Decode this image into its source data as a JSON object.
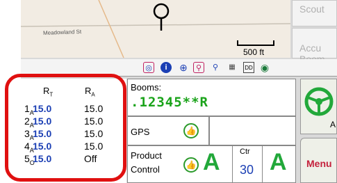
{
  "map": {
    "road_label": "Meadowland St",
    "scale_label": "500 ft"
  },
  "right_column": {
    "scout_label": "Scout",
    "accu_boom_label": "Accu\nBoom"
  },
  "toolbar": {
    "icons": [
      "position-marker-icon",
      "info-icon",
      "crosshair-icon",
      "zoom-in-icon",
      "zoom-out-icon",
      "grid-icon",
      "dd-icon",
      "globe-icon"
    ]
  },
  "rates": {
    "target_header": "RT",
    "actual_header": "RA",
    "rows": [
      {
        "section": "1",
        "section_sub": "A",
        "target": "15.0",
        "actual": "15.0"
      },
      {
        "section": "2",
        "section_sub": "A",
        "target": "15.0",
        "actual": "15.0"
      },
      {
        "section": "3",
        "section_sub": "A",
        "target": "15.0",
        "actual": "15.0"
      },
      {
        "section": "4",
        "section_sub": "A",
        "target": "15.0",
        "actual": "15.0"
      },
      {
        "section": "5",
        "section_sub": "O",
        "target": "15.0",
        "actual": "Off"
      }
    ]
  },
  "booms": {
    "label": "Booms:",
    "status": ".12345**R"
  },
  "gps": {
    "label": "GPS"
  },
  "product_control": {
    "label_line1": "Product",
    "label_line2": "Control",
    "mode_a": "A",
    "ctr_label": "Ctr",
    "ctr_value": "30",
    "mode_a2": "A"
  },
  "side": {
    "steering_a": "A",
    "menu_label": "Menu"
  },
  "colors": {
    "target_blue": "#1b3fb4",
    "status_green": "#1aa31a",
    "highlight_red": "#e01010"
  }
}
